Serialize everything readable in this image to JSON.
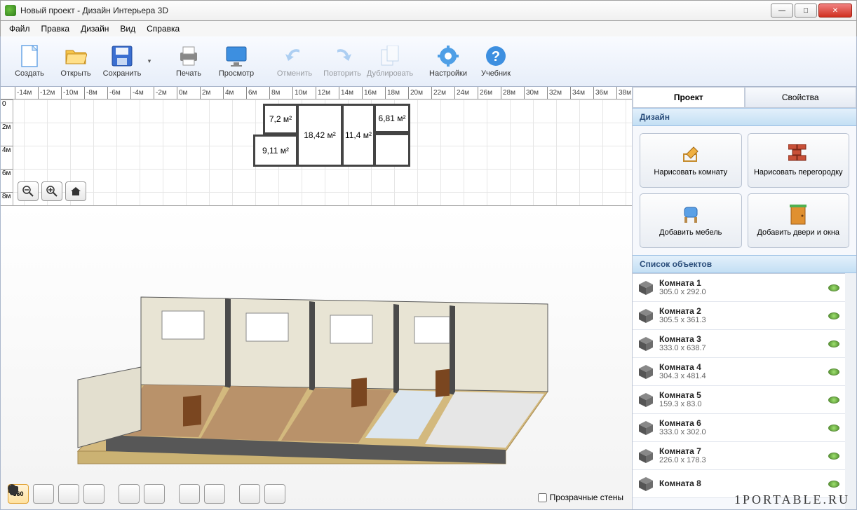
{
  "window": {
    "title": "Новый проект - Дизайн Интерьера 3D"
  },
  "menu": {
    "file": "Файл",
    "edit": "Правка",
    "design": "Дизайн",
    "view": "Вид",
    "help": "Справка"
  },
  "toolbar": {
    "create": "Создать",
    "open": "Открыть",
    "save": "Сохранить",
    "print": "Печать",
    "preview": "Просмотр",
    "undo": "Отменить",
    "redo": "Повторить",
    "duplicate": "Дублировать",
    "settings": "Настройки",
    "tutorial": "Учебник"
  },
  "ruler_h": [
    "-14м",
    "-12м",
    "-10м",
    "-8м",
    "-6м",
    "-4м",
    "-2м",
    "0м",
    "2м",
    "4м",
    "6м",
    "8м",
    "10м",
    "12м",
    "14м",
    "16м",
    "18м",
    "20м",
    "22м",
    "24м",
    "26м",
    "28м",
    "30м",
    "32м",
    "34м",
    "36м",
    "38м"
  ],
  "ruler_v": [
    "0",
    "2м",
    "4м",
    "6м",
    "8м"
  ],
  "rooms2d": [
    {
      "label": "7,2 м²"
    },
    {
      "label": "18,42 м²"
    },
    {
      "label": "11,4 м²"
    },
    {
      "label": "6,81 м²"
    },
    {
      "label": "9,11 м²"
    }
  ],
  "tabs": {
    "project": "Проект",
    "properties": "Свойства"
  },
  "sections": {
    "design": "Дизайн",
    "objects": "Список объектов"
  },
  "design_buttons": {
    "draw_room": "Нарисовать комнату",
    "draw_partition": "Нарисовать перегородку",
    "add_furniture": "Добавить мебель",
    "add_doors": "Добавить двери и окна"
  },
  "objects": [
    {
      "name": "Комната 1",
      "dims": "305.0 x 292.0"
    },
    {
      "name": "Комната 2",
      "dims": "305.5 x 361.3"
    },
    {
      "name": "Комната 3",
      "dims": "333.0 x 638.7"
    },
    {
      "name": "Комната 4",
      "dims": "304.3 x 481.4"
    },
    {
      "name": "Комната 5",
      "dims": "159.3 x 83.0"
    },
    {
      "name": "Комната 6",
      "dims": "333.0 x 302.0"
    },
    {
      "name": "Комната 7",
      "dims": "226.0 x 178.3"
    },
    {
      "name": "Комната 8",
      "dims": ""
    }
  ],
  "checkbox": {
    "transparent_walls": "Прозрачные стены"
  },
  "watermark": "1PORTABLE.RU"
}
